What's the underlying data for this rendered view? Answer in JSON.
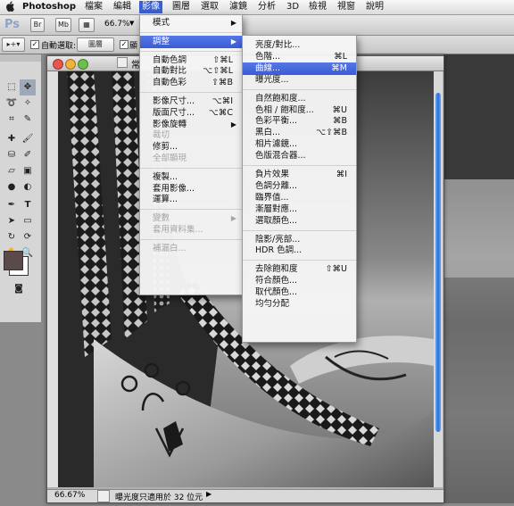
{
  "menubar": {
    "apple": "",
    "app_name": "Photoshop",
    "items": [
      "檔案",
      "編輯",
      "影像",
      "圖層",
      "選取",
      "濾鏡",
      "分析",
      "3D",
      "檢視",
      "視窗",
      "說明"
    ],
    "active_index": 2
  },
  "appbar": {
    "ps_logo": "Ps",
    "br_label": "Br",
    "mb_label": "Mb",
    "zoom": "66.7%"
  },
  "options": {
    "auto_select_label": "自動選取:",
    "auto_select_value": "圖層",
    "other_check_label": "顯"
  },
  "document": {
    "title": "常",
    "zoom": "66.67%",
    "status": "曝光度只適用於 32 位元"
  },
  "image_menu": {
    "items": [
      {
        "label": "模式",
        "shortcut": "",
        "arrow": true,
        "disabled": false,
        "highlight": false
      },
      {
        "sep": true
      },
      {
        "label": "調整",
        "shortcut": "",
        "arrow": true,
        "disabled": false,
        "highlight": true
      },
      {
        "sep": true
      },
      {
        "label": "自動色調",
        "shortcut": "⇧⌘L",
        "arrow": false,
        "disabled": false,
        "highlight": false
      },
      {
        "label": "自動對比",
        "shortcut": "⌥⇧⌘L",
        "arrow": false,
        "disabled": false,
        "highlight": false
      },
      {
        "label": "自動色彩",
        "shortcut": "⇧⌘B",
        "arrow": false,
        "disabled": false,
        "highlight": false
      },
      {
        "sep": true
      },
      {
        "label": "影像尺寸...",
        "shortcut": "⌥⌘I",
        "arrow": false,
        "disabled": false,
        "highlight": false
      },
      {
        "label": "版面尺寸...",
        "shortcut": "⌥⌘C",
        "arrow": false,
        "disabled": false,
        "highlight": false
      },
      {
        "label": "影像旋轉",
        "shortcut": "",
        "arrow": true,
        "disabled": false,
        "highlight": false
      },
      {
        "label": "裁切",
        "shortcut": "",
        "arrow": false,
        "disabled": true,
        "highlight": false
      },
      {
        "label": "修剪...",
        "shortcut": "",
        "arrow": false,
        "disabled": false,
        "highlight": false
      },
      {
        "label": "全部顯現",
        "shortcut": "",
        "arrow": false,
        "disabled": true,
        "highlight": false
      },
      {
        "sep": true
      },
      {
        "label": "複製...",
        "shortcut": "",
        "arrow": false,
        "disabled": false,
        "highlight": false
      },
      {
        "label": "套用影像...",
        "shortcut": "",
        "arrow": false,
        "disabled": false,
        "highlight": false
      },
      {
        "label": "運算...",
        "shortcut": "",
        "arrow": false,
        "disabled": false,
        "highlight": false
      },
      {
        "sep": true
      },
      {
        "label": "變數",
        "shortcut": "",
        "arrow": true,
        "disabled": true,
        "highlight": false
      },
      {
        "label": "套用資料集...",
        "shortcut": "",
        "arrow": false,
        "disabled": true,
        "highlight": false
      },
      {
        "sep": true
      },
      {
        "label": "補漏白...",
        "shortcut": "",
        "arrow": false,
        "disabled": true,
        "highlight": false
      }
    ]
  },
  "adjust_menu": {
    "items": [
      {
        "label": "亮度/對比...",
        "shortcut": "",
        "highlight": false
      },
      {
        "label": "色階...",
        "shortcut": "⌘L",
        "highlight": false
      },
      {
        "label": "曲線...",
        "shortcut": "⌘M",
        "highlight": true
      },
      {
        "label": "曝光度...",
        "shortcut": "",
        "highlight": false
      },
      {
        "sep": true
      },
      {
        "label": "自然飽和度...",
        "shortcut": "",
        "highlight": false
      },
      {
        "label": "色相 / 飽和度...",
        "shortcut": "⌘U",
        "highlight": false
      },
      {
        "label": "色彩平衡...",
        "shortcut": "⌘B",
        "highlight": false
      },
      {
        "label": "黑白...",
        "shortcut": "⌥⇧⌘B",
        "highlight": false
      },
      {
        "label": "相片濾鏡...",
        "shortcut": "",
        "highlight": false
      },
      {
        "label": "色版混合器...",
        "shortcut": "",
        "highlight": false
      },
      {
        "sep": true
      },
      {
        "label": "負片效果",
        "shortcut": "⌘I",
        "highlight": false
      },
      {
        "label": "色調分離...",
        "shortcut": "",
        "highlight": false
      },
      {
        "label": "臨界值...",
        "shortcut": "",
        "highlight": false
      },
      {
        "label": "漸層對應...",
        "shortcut": "",
        "highlight": false
      },
      {
        "label": "選取顏色...",
        "shortcut": "",
        "highlight": false
      },
      {
        "sep": true
      },
      {
        "label": "陰影/亮部...",
        "shortcut": "",
        "highlight": false
      },
      {
        "label": "HDR 色調...",
        "shortcut": "",
        "highlight": false
      },
      {
        "sep": true
      },
      {
        "label": "去除飽和度",
        "shortcut": "⇧⌘U",
        "highlight": false
      },
      {
        "label": "符合顏色...",
        "shortcut": "",
        "highlight": false
      },
      {
        "label": "取代顏色...",
        "shortcut": "",
        "highlight": false
      },
      {
        "label": "均勻分配",
        "shortcut": "",
        "highlight": false
      }
    ]
  },
  "colors": {
    "highlight": "#3a5bd4",
    "foreground_swatch": "#5a4a4a",
    "background_swatch": "#ffffff"
  }
}
